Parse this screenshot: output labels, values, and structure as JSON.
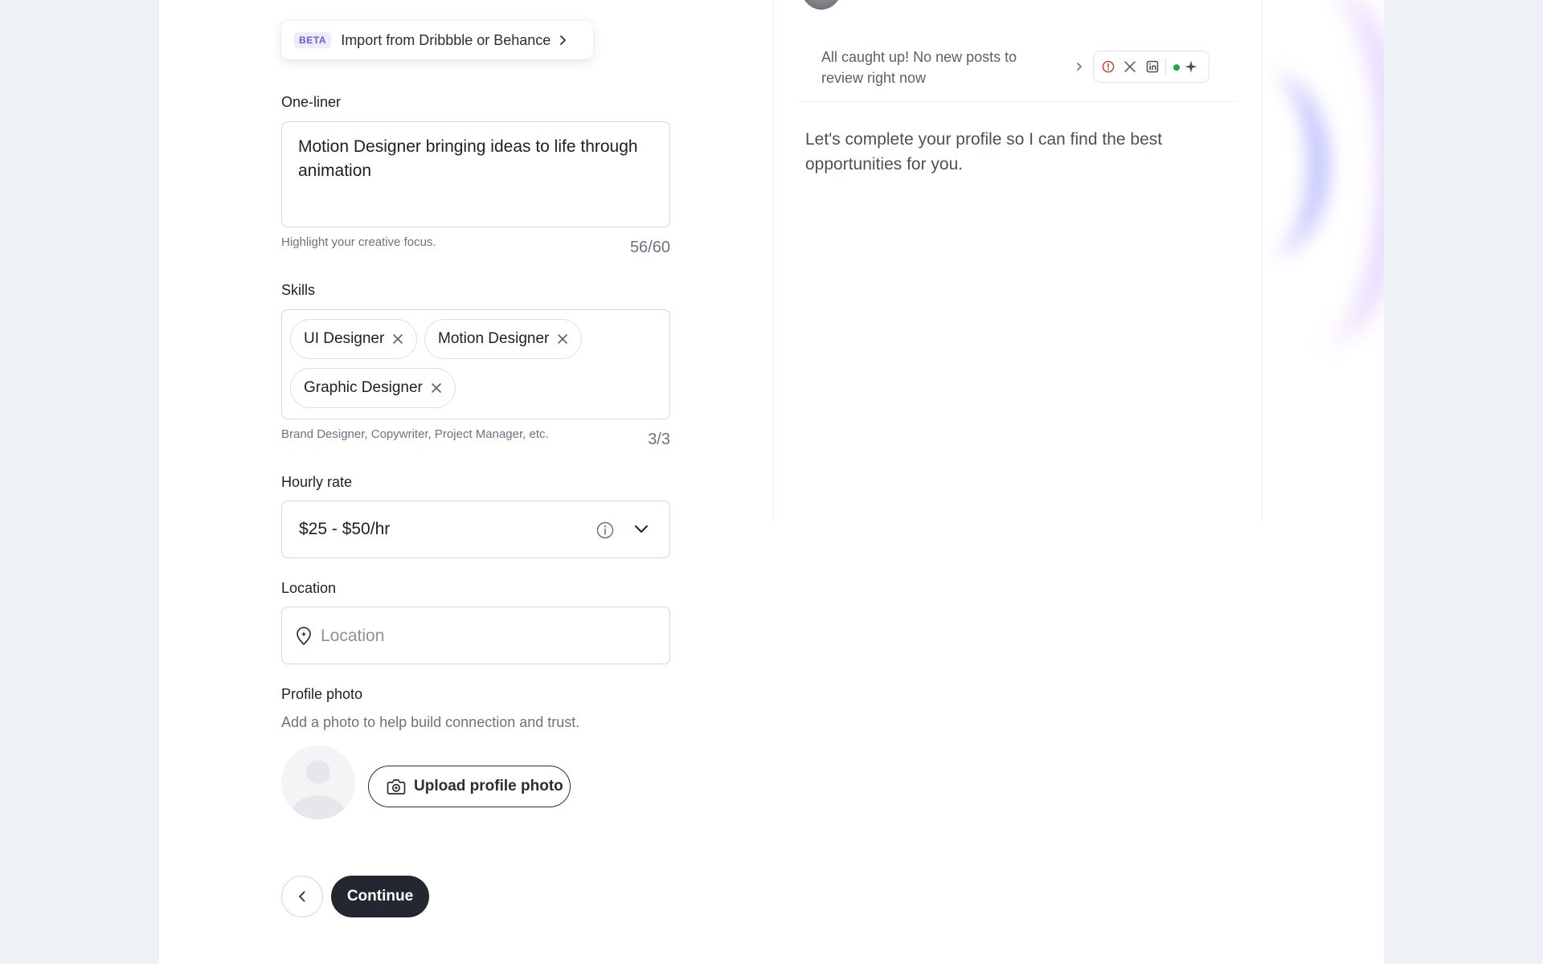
{
  "import": {
    "badge": "BETA",
    "label": "Import from Dribbble or Behance"
  },
  "one_liner": {
    "label": "One-liner",
    "value": "Motion Designer bringing ideas to life through animation",
    "hint": "Highlight your creative focus.",
    "count": "56/60"
  },
  "skills": {
    "label": "Skills",
    "chips": [
      "UI Designer",
      "Motion Designer",
      "Graphic Designer"
    ],
    "hint": "Brand Designer, Copywriter, Project Manager, etc.",
    "count": "3/3"
  },
  "hourly_rate": {
    "label": "Hourly rate",
    "value": "$25 - $50/hr"
  },
  "location": {
    "label": "Location",
    "placeholder": "Location"
  },
  "profile_photo": {
    "label": "Profile photo",
    "description": "Add a photo to help build connection and trust.",
    "upload_label": "Upload profile photo"
  },
  "nav": {
    "continue_label": "Continue"
  },
  "preview": {
    "notice": "All caught up! No new posts to review right now",
    "message": "Let's complete your profile so I can find the best opportunities for you.",
    "social_icons": [
      "alert-icon",
      "x-icon",
      "linkedin-icon",
      "status-dot",
      "sparkle-icon"
    ]
  },
  "colors": {
    "accent_dark": "#23272f",
    "beta": "#6b5bd6",
    "status_green": "#22a35a",
    "alert_red": "#c0392b"
  }
}
